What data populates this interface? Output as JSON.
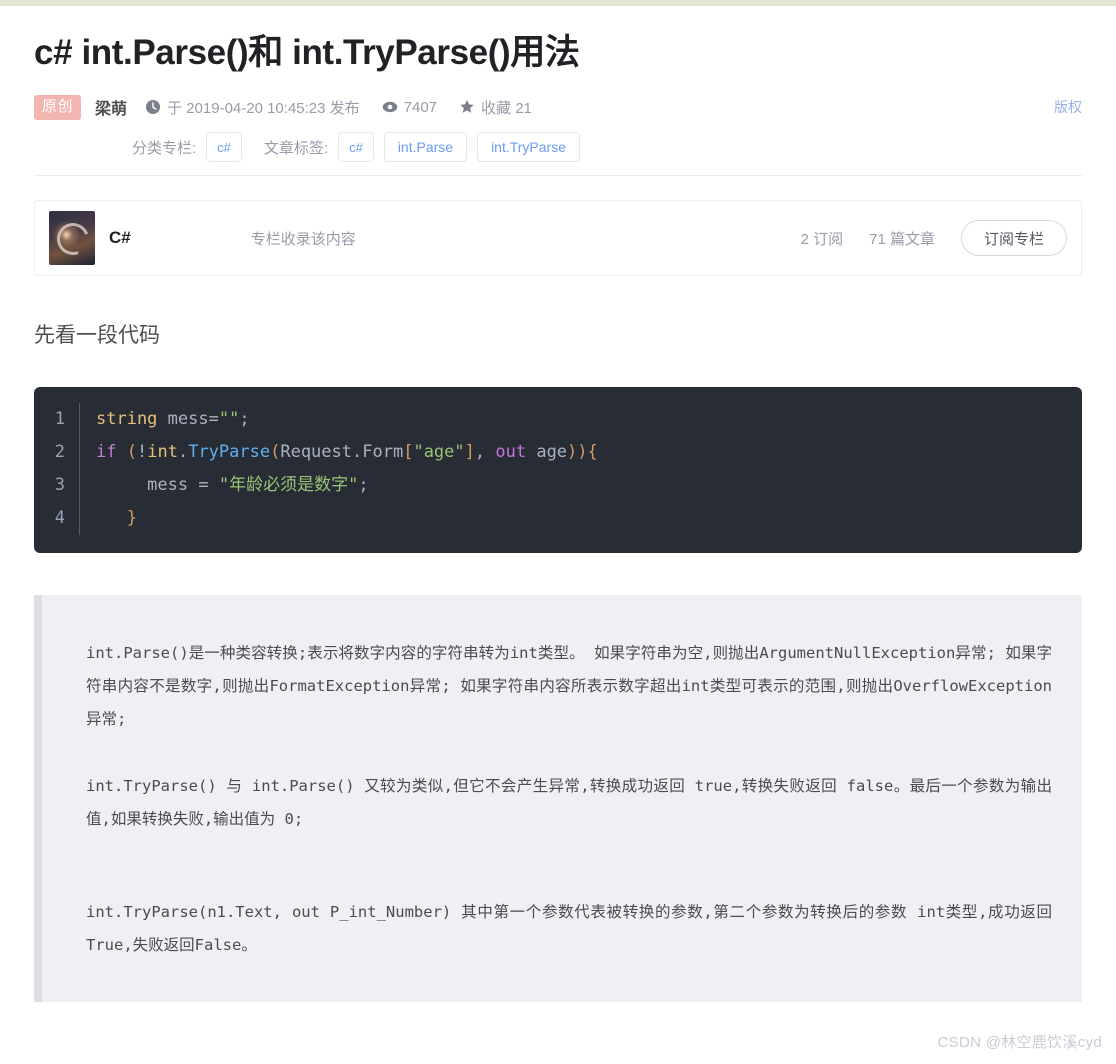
{
  "site": {
    "watermark": "CSDN @林空鹿饮溪cyd"
  },
  "article": {
    "title": "c# int.Parse()和 int.TryParse()用法",
    "original_badge": "原创",
    "author": "梁萌",
    "publish_text": "于 2019-04-20 10:45:23 发布",
    "views": "7407",
    "collect_label": "收藏 21",
    "copyright": "版权",
    "category_label": "分类专栏:",
    "category_tags": [
      "c#"
    ],
    "tags_label": "文章标签:",
    "tags": [
      "c#",
      "int.Parse",
      "int.TryParse"
    ]
  },
  "column_card": {
    "name": "C#",
    "description": "专栏收录该内容",
    "subscribers": "2 订阅",
    "articles": "71 篇文章",
    "subscribe_button": "订阅专栏"
  },
  "content": {
    "section_heading": "先看一段代码",
    "code": {
      "language": "csharp",
      "lines": [
        {
          "no": "1",
          "text": "string mess=\"\";"
        },
        {
          "no": "2",
          "text": "if (!int.TryParse(Request.Form[\"age\"], out age)){"
        },
        {
          "no": "3",
          "text": "    mess = \"年龄必须是数字\";"
        },
        {
          "no": "4",
          "text": "  }"
        }
      ]
    },
    "note_paragraphs": [
      "int.Parse()是一种类容转换;表示将数字内容的字符串转为int类型。 如果字符串为空,则抛出ArgumentNullException异常; 如果字符串内容不是数字,则抛出FormatException异常; 如果字符串内容所表示数字超出int类型可表示的范围,则抛出OverflowException异常;",
      "int.TryParse() 与 int.Parse() 又较为类似,但它不会产生异常,转换成功返回 true,转换失败返回 false。最后一个参数为输出值,如果转换失败,输出值为 0;",
      "int.TryParse(n1.Text, out P_int_Number) 其中第一个参数代表被转换的参数,第二个参数为转换后的参数 int类型,成功返回True,失败返回False。"
    ]
  },
  "colors": {
    "accent_link": "#6a9bf4",
    "badge_original": "#f3b5b0",
    "code_bg": "#282c34",
    "note_bg": "#eef0f4",
    "note_border": "#dcdee3",
    "top_strip": "#e3e6cf"
  }
}
